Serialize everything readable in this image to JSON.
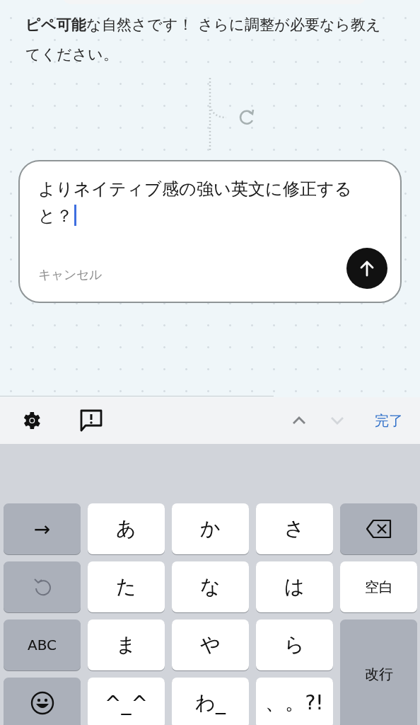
{
  "chat": {
    "message": "**ピペ可能**な自然さです！ さらに調整が必要なら教えてください。"
  },
  "composer": {
    "value": "よりネイティブ感の強い英文に修正すると？",
    "cancel": "キャンセル"
  },
  "toolbar": {
    "up_disabled": false,
    "down_disabled": true,
    "done": "完了"
  },
  "keyboard": [
    {
      "kind": "function",
      "label": "→"
    },
    {
      "kind": "letter",
      "label": "あ"
    },
    {
      "kind": "letter",
      "label": "か"
    },
    {
      "kind": "letter",
      "label": "さ"
    },
    {
      "kind": "delete"
    },
    {
      "kind": "undo"
    },
    {
      "kind": "letter",
      "label": "た"
    },
    {
      "kind": "letter",
      "label": "な"
    },
    {
      "kind": "letter",
      "label": "は"
    },
    {
      "kind": "space",
      "label": "空白"
    },
    {
      "kind": "function",
      "label": "ABC"
    },
    {
      "kind": "letter",
      "label": "ま"
    },
    {
      "kind": "letter",
      "label": "や"
    },
    {
      "kind": "letter",
      "label": "ら"
    },
    {
      "kind": "return",
      "label": "改行"
    },
    {
      "kind": "emoji"
    },
    {
      "kind": "letter",
      "label": "^_^"
    },
    {
      "kind": "letter",
      "label": "わ_"
    },
    {
      "kind": "letter",
      "label": "、。?!"
    }
  ]
}
